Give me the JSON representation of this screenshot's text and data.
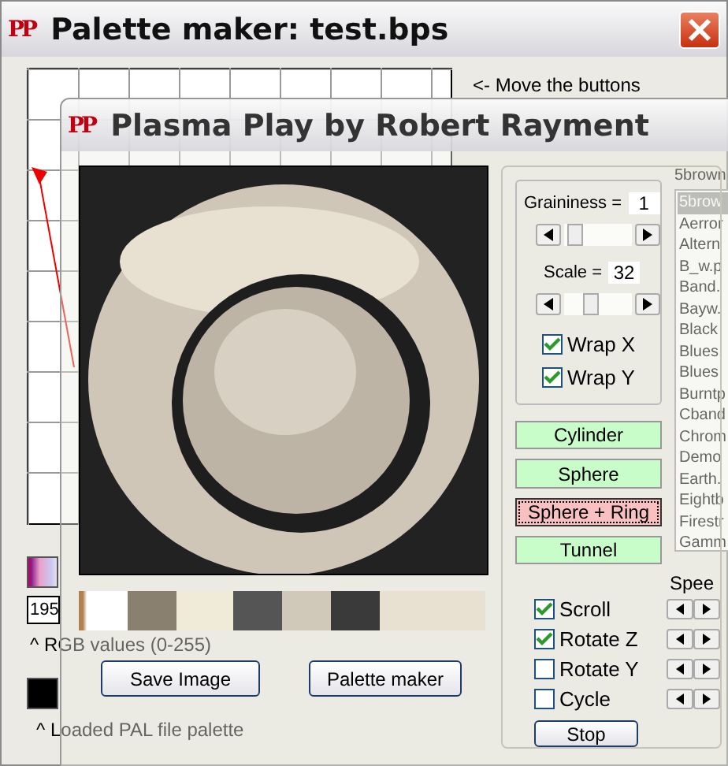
{
  "back_window": {
    "logo": "PP",
    "title": "Palette maker:  test.bps",
    "hint": "<- Move the buttons",
    "list_title": "5brown",
    "list_items": [
      {
        "label": "5brow",
        "selected": true
      },
      {
        "label": "Aerror",
        "selected": false
      },
      {
        "label": "Altern",
        "selected": false
      },
      {
        "label": "B_w.p",
        "selected": false
      },
      {
        "label": "Band.",
        "selected": false
      },
      {
        "label": "Bayw.",
        "selected": false
      },
      {
        "label": "Black",
        "selected": false
      },
      {
        "label": "Blues.",
        "selected": false
      },
      {
        "label": "Blues",
        "selected": false
      },
      {
        "label": "Burntp",
        "selected": false
      },
      {
        "label": "Cband",
        "selected": false
      },
      {
        "label": "Chrom",
        "selected": false
      },
      {
        "label": "Demo",
        "selected": false
      },
      {
        "label": "Earth.",
        "selected": false
      },
      {
        "label": "Eightb",
        "selected": false
      },
      {
        "label": "Firestr",
        "selected": false
      },
      {
        "label": "Gamm",
        "selected": false
      }
    ],
    "rgb_value": "195",
    "rgb_caption": "^ RGB values (0-255)",
    "pal_caption": "^ Loaded PAL file palette"
  },
  "front_window": {
    "logo": "PP",
    "title": "Plasma Play by Robert Rayment",
    "buttons": [
      "Save Image",
      "Palette maker"
    ],
    "graininess": {
      "label": "Graininess =",
      "value": "1",
      "level": 0.1
    },
    "scale": {
      "label": "Scale =",
      "value": "32",
      "level": 0.3
    },
    "wrap": [
      {
        "label": "Wrap X",
        "checked": true
      },
      {
        "label": "Wrap Y",
        "checked": true
      }
    ],
    "shapes": [
      {
        "label": "Cylinder",
        "selected": false
      },
      {
        "label": "Sphere",
        "selected": false
      },
      {
        "label": "Sphere + Ring",
        "selected": true
      },
      {
        "label": "Tunnel",
        "selected": false
      }
    ],
    "speed_label": "Spee",
    "motions": [
      {
        "label": "Scroll",
        "checked": true
      },
      {
        "label": "Rotate Z",
        "checked": true
      },
      {
        "label": "Rotate Y",
        "checked": false
      },
      {
        "label": "Cycle",
        "checked": false
      }
    ],
    "stop_button": "Stop"
  }
}
